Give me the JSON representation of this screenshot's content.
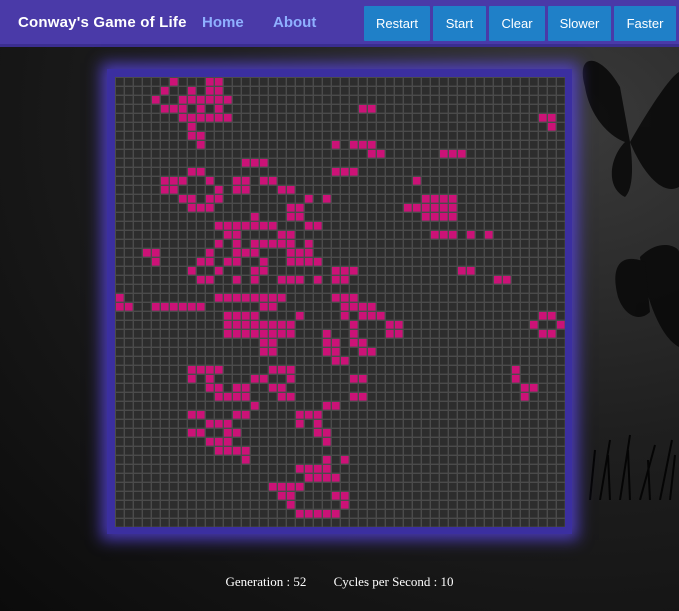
{
  "nav": {
    "brand": "Conway's Game of Life",
    "links": [
      "Home",
      "About"
    ],
    "buttons": [
      "Restart",
      "Start",
      "Clear",
      "Slower",
      "Faster"
    ]
  },
  "colors": {
    "navbar": "#4a3aa8",
    "button": "#1f80c8",
    "link": "#8fb0ff",
    "alive_cell": "#cc1277",
    "dead_cell": "#2d2d2d",
    "grid_line": "#4b4b4b",
    "board_frame": "#3b2fa0"
  },
  "grid": {
    "columns": 50,
    "rows": 50,
    "alive": [
      [
        6,
        0
      ],
      [
        10,
        0
      ],
      [
        11,
        0
      ],
      [
        5,
        1
      ],
      [
        8,
        1
      ],
      [
        10,
        1
      ],
      [
        11,
        1
      ],
      [
        4,
        2
      ],
      [
        7,
        2
      ],
      [
        8,
        2
      ],
      [
        9,
        2
      ],
      [
        10,
        2
      ],
      [
        11,
        2
      ],
      [
        12,
        2
      ],
      [
        5,
        3
      ],
      [
        6,
        3
      ],
      [
        7,
        3
      ],
      [
        9,
        3
      ],
      [
        11,
        3
      ],
      [
        27,
        3
      ],
      [
        28,
        3
      ],
      [
        7,
        4
      ],
      [
        8,
        4
      ],
      [
        9,
        4
      ],
      [
        10,
        4
      ],
      [
        11,
        4
      ],
      [
        12,
        4
      ],
      [
        47,
        4
      ],
      [
        48,
        4
      ],
      [
        8,
        5
      ],
      [
        48,
        5
      ],
      [
        8,
        6
      ],
      [
        9,
        6
      ],
      [
        9,
        7
      ],
      [
        27,
        7
      ],
      [
        28,
        7
      ],
      [
        24,
        7
      ],
      [
        26,
        7
      ],
      [
        28,
        8
      ],
      [
        29,
        8
      ],
      [
        36,
        8
      ],
      [
        37,
        8
      ],
      [
        38,
        8
      ],
      [
        14,
        9
      ],
      [
        15,
        9
      ],
      [
        16,
        9
      ],
      [
        8,
        10
      ],
      [
        9,
        10
      ],
      [
        24,
        10
      ],
      [
        25,
        10
      ],
      [
        26,
        10
      ],
      [
        5,
        11
      ],
      [
        6,
        11
      ],
      [
        7,
        11
      ],
      [
        10,
        11
      ],
      [
        13,
        11
      ],
      [
        14,
        11
      ],
      [
        16,
        11
      ],
      [
        17,
        11
      ],
      [
        33,
        11
      ],
      [
        5,
        12
      ],
      [
        6,
        12
      ],
      [
        11,
        12
      ],
      [
        13,
        12
      ],
      [
        14,
        12
      ],
      [
        18,
        12
      ],
      [
        19,
        12
      ],
      [
        7,
        13
      ],
      [
        8,
        13
      ],
      [
        10,
        13
      ],
      [
        11,
        13
      ],
      [
        21,
        13
      ],
      [
        23,
        13
      ],
      [
        34,
        13
      ],
      [
        35,
        13
      ],
      [
        36,
        13
      ],
      [
        37,
        13
      ],
      [
        8,
        14
      ],
      [
        9,
        14
      ],
      [
        10,
        14
      ],
      [
        19,
        14
      ],
      [
        20,
        14
      ],
      [
        32,
        14
      ],
      [
        33,
        14
      ],
      [
        34,
        14
      ],
      [
        35,
        14
      ],
      [
        36,
        14
      ],
      [
        37,
        14
      ],
      [
        15,
        15
      ],
      [
        19,
        15
      ],
      [
        20,
        15
      ],
      [
        34,
        15
      ],
      [
        35,
        15
      ],
      [
        36,
        15
      ],
      [
        37,
        15
      ],
      [
        11,
        16
      ],
      [
        12,
        16
      ],
      [
        13,
        16
      ],
      [
        14,
        16
      ],
      [
        15,
        16
      ],
      [
        16,
        16
      ],
      [
        17,
        16
      ],
      [
        21,
        16
      ],
      [
        22,
        16
      ],
      [
        12,
        17
      ],
      [
        13,
        17
      ],
      [
        18,
        17
      ],
      [
        19,
        17
      ],
      [
        35,
        17
      ],
      [
        36,
        17
      ],
      [
        37,
        17
      ],
      [
        39,
        17
      ],
      [
        41,
        17
      ],
      [
        11,
        18
      ],
      [
        13,
        18
      ],
      [
        15,
        18
      ],
      [
        16,
        18
      ],
      [
        17,
        18
      ],
      [
        18,
        18
      ],
      [
        19,
        18
      ],
      [
        21,
        18
      ],
      [
        3,
        19
      ],
      [
        4,
        19
      ],
      [
        10,
        19
      ],
      [
        13,
        19
      ],
      [
        14,
        19
      ],
      [
        15,
        19
      ],
      [
        19,
        19
      ],
      [
        20,
        19
      ],
      [
        21,
        19
      ],
      [
        4,
        20
      ],
      [
        9,
        20
      ],
      [
        10,
        20
      ],
      [
        12,
        20
      ],
      [
        13,
        20
      ],
      [
        16,
        20
      ],
      [
        19,
        20
      ],
      [
        20,
        20
      ],
      [
        21,
        20
      ],
      [
        22,
        20
      ],
      [
        8,
        21
      ],
      [
        11,
        21
      ],
      [
        15,
        21
      ],
      [
        16,
        21
      ],
      [
        24,
        21
      ],
      [
        25,
        21
      ],
      [
        26,
        21
      ],
      [
        38,
        21
      ],
      [
        39,
        21
      ],
      [
        9,
        22
      ],
      [
        10,
        22
      ],
      [
        13,
        22
      ],
      [
        15,
        22
      ],
      [
        18,
        22
      ],
      [
        19,
        22
      ],
      [
        20,
        22
      ],
      [
        22,
        22
      ],
      [
        24,
        22
      ],
      [
        25,
        22
      ],
      [
        42,
        22
      ],
      [
        43,
        22
      ],
      [
        0,
        24
      ],
      [
        11,
        24
      ],
      [
        12,
        24
      ],
      [
        13,
        24
      ],
      [
        14,
        24
      ],
      [
        15,
        24
      ],
      [
        16,
        24
      ],
      [
        17,
        24
      ],
      [
        18,
        24
      ],
      [
        24,
        24
      ],
      [
        25,
        24
      ],
      [
        26,
        24
      ],
      [
        0,
        25
      ],
      [
        1,
        25
      ],
      [
        4,
        25
      ],
      [
        5,
        25
      ],
      [
        6,
        25
      ],
      [
        7,
        25
      ],
      [
        8,
        25
      ],
      [
        9,
        25
      ],
      [
        16,
        25
      ],
      [
        17,
        25
      ],
      [
        25,
        25
      ],
      [
        26,
        25
      ],
      [
        27,
        25
      ],
      [
        28,
        25
      ],
      [
        12,
        26
      ],
      [
        13,
        26
      ],
      [
        14,
        26
      ],
      [
        15,
        26
      ],
      [
        20,
        26
      ],
      [
        25,
        26
      ],
      [
        27,
        26
      ],
      [
        28,
        26
      ],
      [
        29,
        26
      ],
      [
        47,
        26
      ],
      [
        48,
        26
      ],
      [
        12,
        27
      ],
      [
        13,
        27
      ],
      [
        14,
        27
      ],
      [
        15,
        27
      ],
      [
        16,
        27
      ],
      [
        17,
        27
      ],
      [
        18,
        27
      ],
      [
        19,
        27
      ],
      [
        26,
        27
      ],
      [
        30,
        27
      ],
      [
        31,
        27
      ],
      [
        46,
        27
      ],
      [
        49,
        27
      ],
      [
        12,
        28
      ],
      [
        13,
        28
      ],
      [
        14,
        28
      ],
      [
        15,
        28
      ],
      [
        16,
        28
      ],
      [
        17,
        28
      ],
      [
        18,
        28
      ],
      [
        19,
        28
      ],
      [
        23,
        28
      ],
      [
        26,
        28
      ],
      [
        30,
        28
      ],
      [
        31,
        28
      ],
      [
        47,
        28
      ],
      [
        48,
        28
      ],
      [
        16,
        29
      ],
      [
        17,
        29
      ],
      [
        23,
        29
      ],
      [
        24,
        29
      ],
      [
        26,
        29
      ],
      [
        27,
        29
      ],
      [
        16,
        30
      ],
      [
        17,
        30
      ],
      [
        23,
        30
      ],
      [
        24,
        30
      ],
      [
        27,
        30
      ],
      [
        28,
        30
      ],
      [
        24,
        31
      ],
      [
        25,
        31
      ],
      [
        8,
        32
      ],
      [
        9,
        32
      ],
      [
        10,
        32
      ],
      [
        11,
        32
      ],
      [
        17,
        32
      ],
      [
        18,
        32
      ],
      [
        19,
        32
      ],
      [
        44,
        32
      ],
      [
        8,
        33
      ],
      [
        10,
        33
      ],
      [
        15,
        33
      ],
      [
        16,
        33
      ],
      [
        19,
        33
      ],
      [
        26,
        33
      ],
      [
        27,
        33
      ],
      [
        44,
        33
      ],
      [
        10,
        34
      ],
      [
        11,
        34
      ],
      [
        13,
        34
      ],
      [
        14,
        34
      ],
      [
        17,
        34
      ],
      [
        18,
        34
      ],
      [
        45,
        34
      ],
      [
        46,
        34
      ],
      [
        11,
        35
      ],
      [
        12,
        35
      ],
      [
        13,
        35
      ],
      [
        14,
        35
      ],
      [
        18,
        35
      ],
      [
        19,
        35
      ],
      [
        26,
        35
      ],
      [
        27,
        35
      ],
      [
        45,
        35
      ],
      [
        15,
        36
      ],
      [
        23,
        36
      ],
      [
        24,
        36
      ],
      [
        8,
        37
      ],
      [
        9,
        37
      ],
      [
        13,
        37
      ],
      [
        14,
        37
      ],
      [
        20,
        37
      ],
      [
        21,
        37
      ],
      [
        22,
        37
      ],
      [
        10,
        38
      ],
      [
        11,
        38
      ],
      [
        12,
        38
      ],
      [
        20,
        38
      ],
      [
        22,
        38
      ],
      [
        8,
        39
      ],
      [
        9,
        39
      ],
      [
        12,
        39
      ],
      [
        13,
        39
      ],
      [
        22,
        39
      ],
      [
        23,
        39
      ],
      [
        10,
        40
      ],
      [
        11,
        40
      ],
      [
        12,
        40
      ],
      [
        23,
        40
      ],
      [
        11,
        41
      ],
      [
        12,
        41
      ],
      [
        13,
        41
      ],
      [
        14,
        41
      ],
      [
        14,
        42
      ],
      [
        23,
        42
      ],
      [
        25,
        42
      ],
      [
        20,
        43
      ],
      [
        21,
        43
      ],
      [
        22,
        43
      ],
      [
        23,
        43
      ],
      [
        21,
        44
      ],
      [
        22,
        44
      ],
      [
        23,
        44
      ],
      [
        24,
        44
      ],
      [
        17,
        45
      ],
      [
        18,
        45
      ],
      [
        19,
        45
      ],
      [
        20,
        45
      ],
      [
        18,
        46
      ],
      [
        19,
        46
      ],
      [
        24,
        46
      ],
      [
        25,
        46
      ],
      [
        19,
        47
      ],
      [
        25,
        47
      ],
      [
        20,
        48
      ],
      [
        21,
        48
      ],
      [
        22,
        48
      ],
      [
        23,
        48
      ],
      [
        24,
        48
      ]
    ]
  },
  "status": {
    "generation": "Generation : 52",
    "cycles": "Cycles per Second : 10"
  }
}
